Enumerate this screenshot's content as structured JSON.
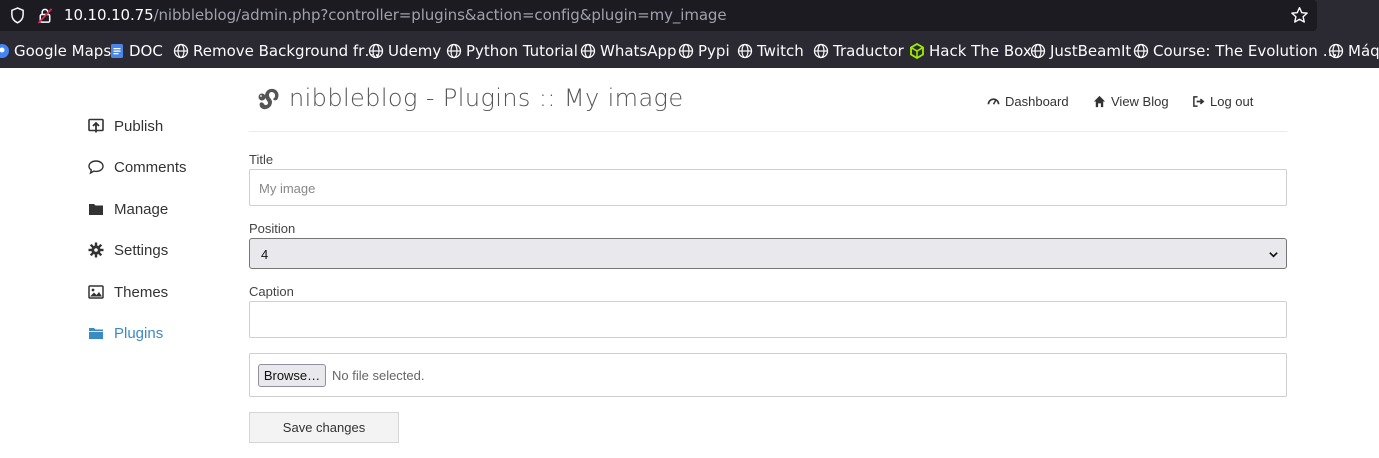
{
  "browser": {
    "url_host": "10.10.10.75",
    "url_path": "/nibbleblog/admin.php?controller=plugins&action=config&plugin=my_image",
    "bookmarks": [
      {
        "label": "Google Maps",
        "icon": "google-maps-icon"
      },
      {
        "label": "DOC",
        "icon": "doc-icon"
      },
      {
        "label": "Remove Background fr…",
        "icon": "globe-icon"
      },
      {
        "label": "Udemy",
        "icon": "globe-icon"
      },
      {
        "label": "Python Tutorial",
        "icon": "globe-icon"
      },
      {
        "label": "WhatsApp",
        "icon": "globe-icon"
      },
      {
        "label": "Pypi",
        "icon": "globe-icon"
      },
      {
        "label": "Twitch",
        "icon": "globe-icon"
      },
      {
        "label": "Traductor",
        "icon": "globe-icon"
      },
      {
        "label": "Hack The Box",
        "icon": "hackthebox-icon"
      },
      {
        "label": "JustBeamIt",
        "icon": "globe-icon"
      },
      {
        "label": "Course: The Evolution …",
        "icon": "globe-icon"
      },
      {
        "label": "Máqu",
        "icon": "globe-icon"
      }
    ]
  },
  "sidebar": {
    "items": [
      {
        "label": "Publish",
        "icon": "publish-icon"
      },
      {
        "label": "Comments",
        "icon": "comment-icon"
      },
      {
        "label": "Manage",
        "icon": "folder-icon"
      },
      {
        "label": "Settings",
        "icon": "gear-icon"
      },
      {
        "label": "Themes",
        "icon": "image-icon"
      },
      {
        "label": "Plugins",
        "icon": "folder-open-icon",
        "active": true
      }
    ]
  },
  "header": {
    "title": "nibbleblog - Plugins :: My image",
    "nav": {
      "dashboard": "Dashboard",
      "view_blog": "View Blog",
      "logout": "Log out"
    }
  },
  "form": {
    "title_label": "Title",
    "title_placeholder": "My image",
    "position_label": "Position",
    "position_value": "4",
    "caption_label": "Caption",
    "caption_value": "",
    "browse_label": "Browse…",
    "no_file_text": "No file selected.",
    "save_label": "Save changes"
  },
  "colors": {
    "accent": "#3b8ac4",
    "chrome_bg": "#2b2a33",
    "urlbar_bg": "#1c1b22"
  }
}
